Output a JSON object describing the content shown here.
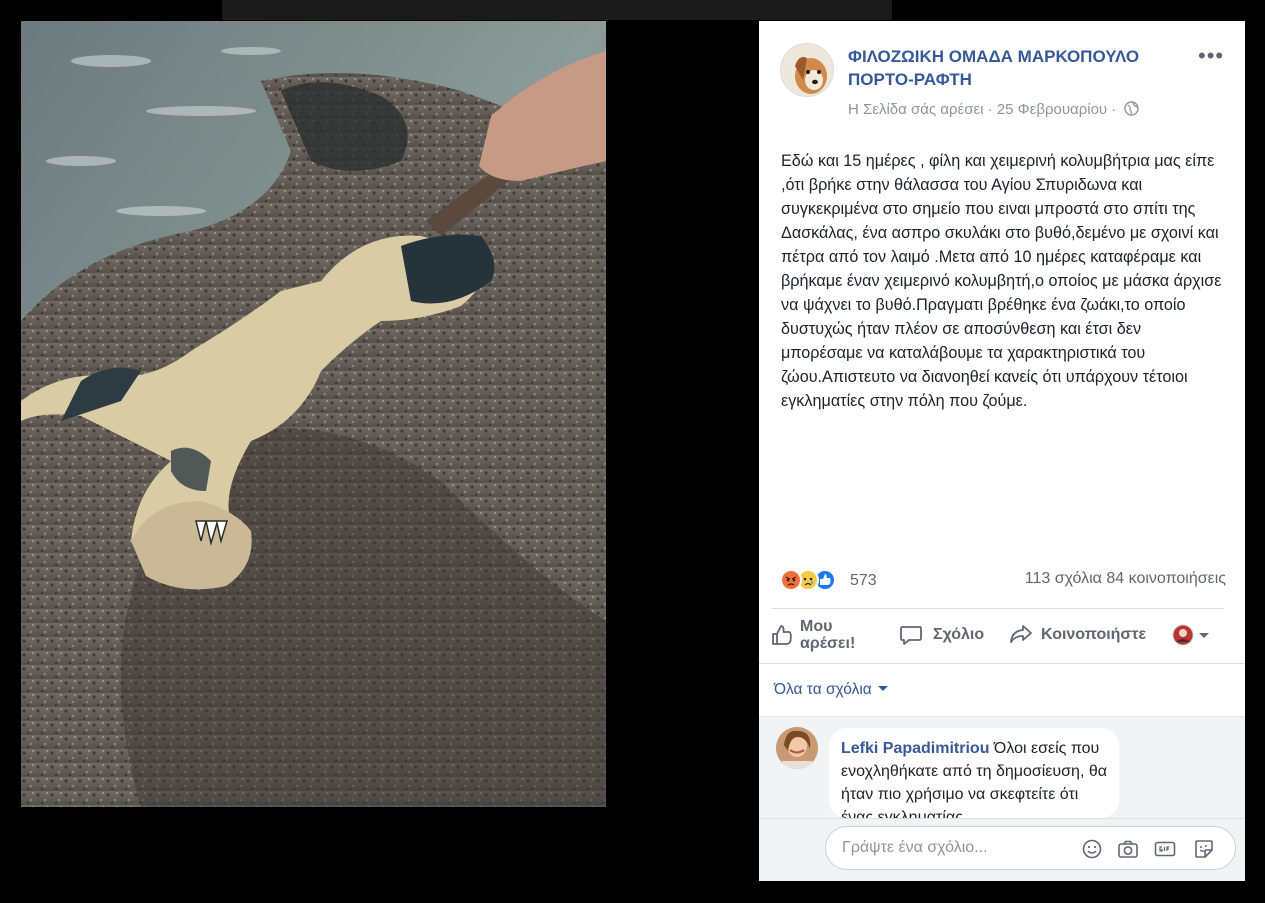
{
  "post": {
    "page_name": "ΦΙΛΟΖΩΙΚΗ ΟΜΑΔΑ ΜΑΡΚΟΠΟΥΛΟ ΠΟΡΤΟ-ΡΑΦΤΗ",
    "liked_note": "Η Σελίδα σάς αρέσει",
    "date": "25 Φεβρουαρίου",
    "separator": "·",
    "more_icon": "more-horizontal-icon",
    "body": "Εδώ και 15 ημέρες , φίλη και χειμερινή κολυμβήτρια μας είπε ,ότι βρήκε στην θάλασσα του Αγίου Σπυριδωνα και συγκεκριμένα στο σημείο που ειναι μπροστά στο σπίτι της Δασκάλας, ένα ασπρο σκυλάκι στο βυθό,δεμένο με σχοινί και πέτρα από τον λαιμό .Μετα από 10 ημέρες καταφέραμε και βρήκαμε έναν χειμερινό κολυμβητή,ο οποίος με μάσκα άρχισε να ψάχνει το βυθό.Πραγματι βρέθηκε ένα ζωάκι,το οποίο δυστυχώς ήταν πλέον σε αποσύνθεση και έτσι δεν μπορέσαμε να καταλάβουμε τα χαρακτηριστικά του ζώου.Απιστευτο να διανοηθεί κανείς ότι υπάρχουν τέτοιοι εγκληματίες στην πόλη που ζούμε."
  },
  "stats": {
    "reaction_count": "573",
    "comments": "113 σχόλια",
    "shares": "84 κοινοποιήσεις",
    "reactions": [
      "angry",
      "sad",
      "like"
    ]
  },
  "actions": {
    "like_line1": "Μου",
    "like_line2": "αρέσει!",
    "comment": "Σχόλιο",
    "share": "Κοινοποιήστε"
  },
  "comments_filter": "Όλα τα σχόλια",
  "comment": {
    "author": "Lefki Papadimitriou",
    "text": "Όλοι εσείς που ενοχληθήκατε από τη δημοσίευση, θα ήταν πιο χρήσιμο να σκεφτείτε ότι ένας εγκληματίας"
  },
  "composer": {
    "placeholder": "Γράψτε ένα σχόλιο...",
    "icons": [
      "emoji-icon",
      "camera-icon",
      "gif-icon",
      "sticker-icon"
    ]
  },
  "colors": {
    "link_blue": "#365899",
    "secondary_text": "#606770",
    "like_blue": "#1877f2",
    "angry_orange": "#f0703a",
    "sad_yellow": "#f7c946"
  }
}
